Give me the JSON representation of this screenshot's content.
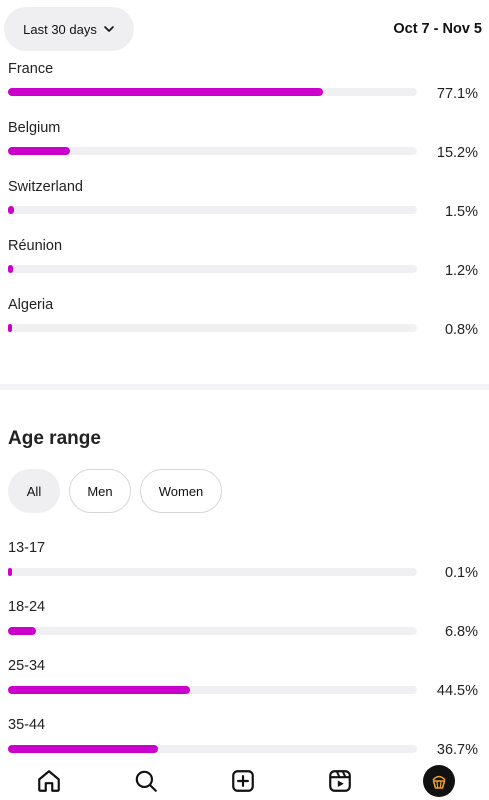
{
  "header": {
    "range_label": "Last 30 days",
    "date_range": "Oct 7 - Nov 5"
  },
  "locations": [
    {
      "label": "France",
      "percent_text": "77.1%",
      "value": 77.1
    },
    {
      "label": "Belgium",
      "percent_text": "15.2%",
      "value": 15.2
    },
    {
      "label": "Switzerland",
      "percent_text": "1.5%",
      "value": 1.5
    },
    {
      "label": "Réunion",
      "percent_text": "1.2%",
      "value": 1.2
    },
    {
      "label": "Algeria",
      "percent_text": "0.8%",
      "value": 0.8
    }
  ],
  "age": {
    "title": "Age range",
    "filters": [
      "All",
      "Men",
      "Women"
    ],
    "selected_filter": "All",
    "rows": [
      {
        "label": "13-17",
        "percent_text": "0.1%",
        "value": 0.1
      },
      {
        "label": "18-24",
        "percent_text": "6.8%",
        "value": 6.8
      },
      {
        "label": "25-34",
        "percent_text": "44.5%",
        "value": 44.5
      },
      {
        "label": "35-44",
        "percent_text": "36.7%",
        "value": 36.7
      }
    ]
  },
  "colors": {
    "bar_fill": "#cc00cc",
    "bar_track": "#f0f0f2",
    "chip_selected": "#efeff2"
  },
  "nav": {
    "icons": [
      "home-icon",
      "search-icon",
      "create-icon",
      "reels-icon",
      "profile-avatar"
    ]
  }
}
